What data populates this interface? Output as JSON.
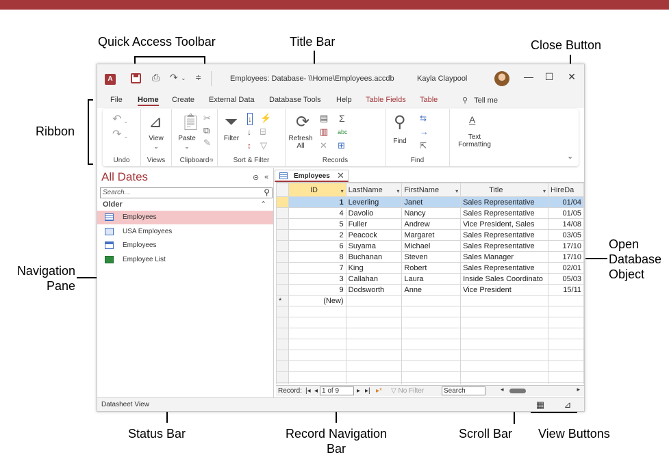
{
  "colors": {
    "accent": "#a4373a",
    "selection_row": "#bcd7f2",
    "active_cell": "#ffe599",
    "nav_selected": "#f4c6c8"
  },
  "callouts": {
    "quick_access_toolbar": "Quick Access Toolbar",
    "title_bar": "Title Bar",
    "close_button": "Close Button",
    "ribbon": "Ribbon",
    "navigation_pane": "Navigation\nPane",
    "open_database_object": "Open\nDatabase\nObject",
    "status_bar": "Status Bar",
    "record_navigation_bar": "Record Navigation\nBar",
    "scroll_bar": "Scroll Bar",
    "view_buttons": "View Buttons"
  },
  "titlebar": {
    "app_icon": "A",
    "title": "Employees: Database- \\\\Home\\Employees.accdb",
    "user": "Kayla Claypool",
    "minimize": "—",
    "maximize": "☐",
    "close": "✕"
  },
  "tabs": [
    "File",
    "Home",
    "Create",
    "External Data",
    "Database Tools",
    "Help",
    "Table Fields",
    "Table"
  ],
  "tell_me": "Tell me",
  "ribbon": {
    "groups": {
      "undo": "Undo",
      "views": "Views",
      "clipboard": "Clipboard",
      "sort_filter": "Sort & Filter",
      "records": "Records",
      "find": "Find"
    },
    "buttons": {
      "view": "View",
      "paste": "Paste",
      "filter": "Filter",
      "refresh": "Refresh",
      "refresh_all": "All",
      "find": "Find",
      "text": "Text",
      "formatting": "Formatting"
    }
  },
  "nav": {
    "title": "All Dates",
    "search_placeholder": "Search...",
    "group": "Older",
    "items": [
      {
        "label": "Employees",
        "icon": "table-icon",
        "selected": true
      },
      {
        "label": "USA Employees",
        "icon": "query-icon"
      },
      {
        "label": "Employees",
        "icon": "form-icon"
      },
      {
        "label": "Employee List",
        "icon": "report-icon"
      }
    ]
  },
  "doc_tab": {
    "label": "Employees",
    "close": "✕"
  },
  "datasheet": {
    "columns": [
      "ID",
      "LastName",
      "FirstName",
      "Title",
      "HireDa"
    ],
    "rows": [
      {
        "id": "1",
        "last": "Leverling",
        "first": "Janet",
        "title": "Sales Representative",
        "hire": "01/04"
      },
      {
        "id": "4",
        "last": "Davolio",
        "first": "Nancy",
        "title": "Sales Representative",
        "hire": "01/05"
      },
      {
        "id": "5",
        "last": "Fuller",
        "first": "Andrew",
        "title": "Vice President, Sales",
        "hire": "14/08"
      },
      {
        "id": "2",
        "last": "Peacock",
        "first": "Margaret",
        "title": "Sales Representative",
        "hire": "03/05"
      },
      {
        "id": "6",
        "last": "Suyama",
        "first": "Michael",
        "title": "Sales Representative",
        "hire": "17/10"
      },
      {
        "id": "8",
        "last": "Buchanan",
        "first": "Steven",
        "title": "Sales Manager",
        "hire": "17/10"
      },
      {
        "id": "7",
        "last": "King",
        "first": "Robert",
        "title": "Sales Representative",
        "hire": "02/01"
      },
      {
        "id": "3",
        "last": "Callahan",
        "first": "Laura",
        "title": "Inside Sales Coordinato",
        "hire": "05/03"
      },
      {
        "id": "9",
        "last": "Dodsworth",
        "first": "Anne",
        "title": "Vice President",
        "hire": "15/11"
      }
    ],
    "new_row": "(New)",
    "new_marker": "*"
  },
  "record_nav": {
    "label": "Record:",
    "position": "1 of 9",
    "no_filter": "No Filter",
    "search": "Search"
  },
  "status": {
    "text": "Datasheet View"
  }
}
